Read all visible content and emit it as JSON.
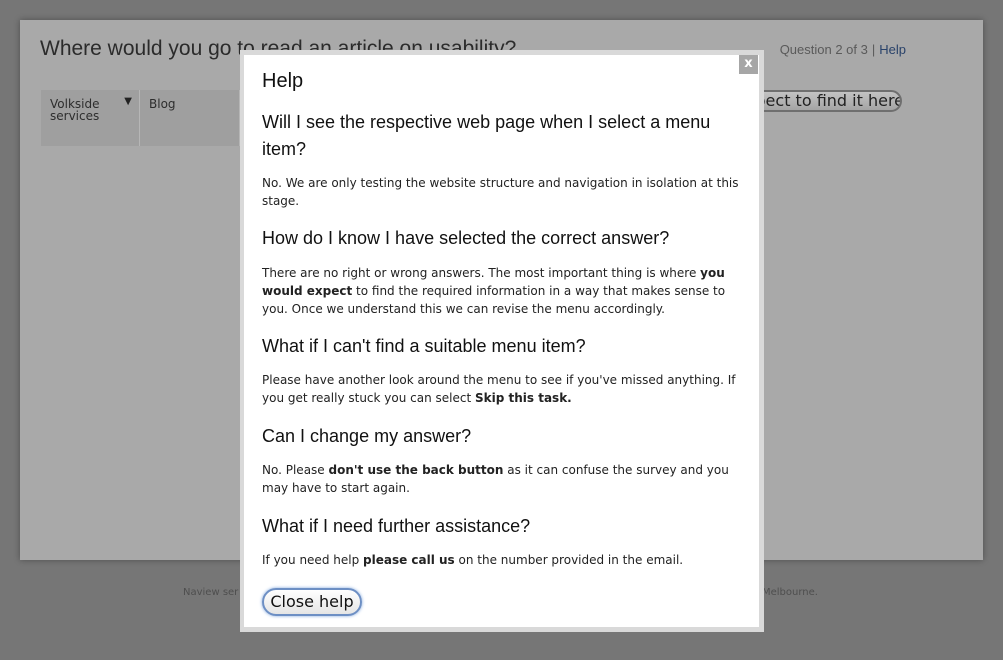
{
  "background": {
    "question": "Where would you go to read an article on usability?",
    "progress": {
      "text": "Question 2 of 3",
      "separator": "|",
      "help_link": "Help"
    },
    "menu": [
      {
        "label": "Volkside services",
        "has_dropdown": true
      },
      {
        "label": "Blog",
        "has_dropdown": false
      }
    ],
    "select_button": "I'd expect to find it here",
    "footer": {
      "left": "Naview ser",
      "right": "Melbourne."
    }
  },
  "modal": {
    "title": "Help",
    "close_x": "x",
    "faq": [
      {
        "question": "Will I see the respective web page when I select a menu item?",
        "answer": [
          {
            "text": "No. We are only testing the website structure and navigation in isolation at this stage.",
            "bold": false
          }
        ]
      },
      {
        "question": "How do I know I have selected the correct answer?",
        "answer": [
          {
            "text": "There are no right or wrong answers. The most important thing is where ",
            "bold": false
          },
          {
            "text": "you would expect",
            "bold": true
          },
          {
            "text": " to find the required information in a way that makes sense to you. Once we understand this we can revise the menu accordingly.",
            "bold": false
          }
        ]
      },
      {
        "question": "What if I can't find a suitable menu item?",
        "answer": [
          {
            "text": "Please have another look around the menu to see if you've missed anything. If you get really stuck you can select ",
            "bold": false
          },
          {
            "text": "Skip this task.",
            "bold": true
          }
        ]
      },
      {
        "question": "Can I change my answer?",
        "answer": [
          {
            "text": "No. Please ",
            "bold": false
          },
          {
            "text": "don't use the back button",
            "bold": true
          },
          {
            "text": " as it can confuse the survey and you may have to start again.",
            "bold": false
          }
        ]
      },
      {
        "question": "What if I need further assistance?",
        "answer": [
          {
            "text": "If you need help ",
            "bold": false
          },
          {
            "text": "please call us",
            "bold": true
          },
          {
            "text": " on the number provided in the email.",
            "bold": false
          }
        ]
      }
    ],
    "close_button": "Close help"
  },
  "colors": {
    "overlay": "#767676",
    "modal_bg": "#ffffff",
    "help_link": "#29426a",
    "focus_ring": "#6d8fc4"
  },
  "icons": {
    "dropdown": "caret-down-icon",
    "close": "close-icon"
  }
}
